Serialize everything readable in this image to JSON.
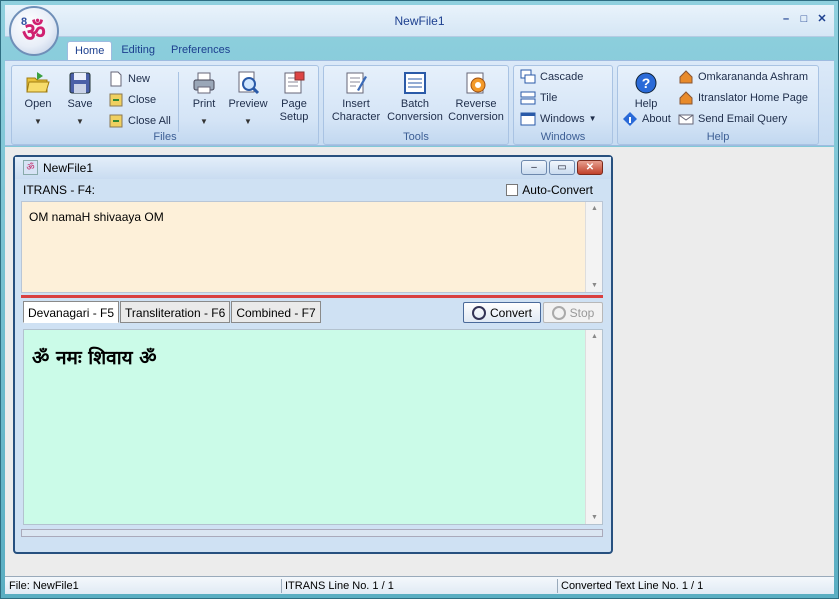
{
  "window": {
    "title": "NewFile1",
    "controls": [
      "minimize",
      "maximize",
      "close"
    ]
  },
  "app_orb": {
    "glyph": "ॐ",
    "badge": "8"
  },
  "ribbon": {
    "tabs": [
      "Home",
      "Editing",
      "Preferences"
    ],
    "active_tab": "Home",
    "groups": {
      "files": {
        "label": "Files",
        "open": "Open",
        "save": "Save",
        "new": "New",
        "close": "Close",
        "close_all": "Close All",
        "print": "Print",
        "preview": "Preview",
        "page_setup_1": "Page",
        "page_setup_2": "Setup"
      },
      "tools": {
        "label": "Tools",
        "insert_1": "Insert",
        "insert_2": "Character",
        "batch_1": "Batch",
        "batch_2": "Conversion",
        "reverse_1": "Reverse",
        "reverse_2": "Conversion"
      },
      "windows": {
        "label": "Windows",
        "cascade": "Cascade",
        "tile": "Tile",
        "windows": "Windows"
      },
      "help": {
        "label": "Help",
        "help": "Help",
        "about": "About",
        "ashram": "Omkarananda Ashram",
        "homepage": "Itranslator Home Page",
        "email": "Send Email Query"
      }
    }
  },
  "document": {
    "title": "NewFile1",
    "itrans_label": "ITRANS - F4:",
    "auto_convert_label": "Auto-Convert",
    "auto_convert_checked": false,
    "itrans_text": "OM namaH shivaaya OM",
    "tabs": [
      "Devanagari - F5",
      "Transliteration - F6",
      "Combined - F7"
    ],
    "active_tab": "Devanagari - F5",
    "convert_label": "Convert",
    "stop_label": "Stop",
    "devanagari_text": "ॐ नमः शिवाय ॐ"
  },
  "statusbar": {
    "file": "File: NewFile1",
    "itrans_line": "ITRANS Line No. 1 / 1",
    "converted_line": "Converted Text Line No. 1 / 1"
  },
  "colors": {
    "itrans_bg": "#fdf0d9",
    "devanagari_bg": "#cbfbe8",
    "splitter": "#d94040",
    "title_text": "#1c3f8f"
  }
}
